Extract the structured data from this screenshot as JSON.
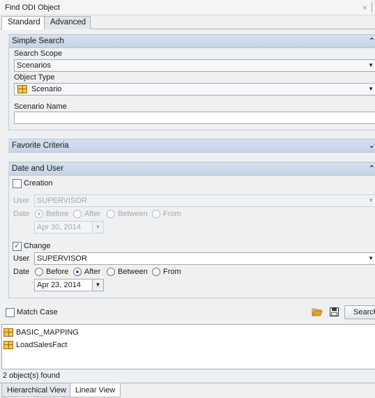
{
  "window": {
    "title": "Find ODI Object",
    "close_glyph": "×"
  },
  "tabs": [
    {
      "label": "Standard"
    },
    {
      "label": "Advanced"
    }
  ],
  "simple_search": {
    "header": "Simple Search",
    "search_scope_label": "Search Scope",
    "search_scope_value": "Scenarios",
    "object_type_label": "Object Type",
    "object_type_value": "Scenario",
    "object_type_icon": "grid-table-icon",
    "scenario_name_label": "Scenario Name",
    "scenario_name_value": ""
  },
  "favorite_criteria": {
    "header": "Favorite Criteria"
  },
  "date_and_user": {
    "header": "Date and User",
    "creation": {
      "label": "Creation",
      "checked": false,
      "user_label": "User",
      "user_value": "SUPERVISOR",
      "date_label": "Date",
      "options": [
        "Before",
        "After",
        "Between",
        "From"
      ],
      "selected": "Before",
      "date_value": "Apr 30, 2014"
    },
    "change": {
      "label": "Change",
      "checked": true,
      "user_label": "User",
      "user_value": "SUPERVISOR",
      "date_label": "Date",
      "options": [
        "Before",
        "After",
        "Between",
        "From"
      ],
      "selected": "After",
      "date_value": "Apr 23, 2014"
    }
  },
  "toolbar": {
    "match_case_label": "Match Case",
    "match_case_checked": false,
    "open_icon": "folder-open-icon",
    "save_icon": "save-disk-icon",
    "search_label": "Search"
  },
  "results": [
    {
      "name": "BASIC_MAPPING",
      "icon": "grid-table-icon"
    },
    {
      "name": "LoadSalesFact",
      "icon": "grid-table-icon"
    }
  ],
  "status": "2 object(s) found",
  "bottom_tabs": [
    {
      "label": "Hierarchical View"
    },
    {
      "label": "Linear View"
    }
  ],
  "colors": {
    "header_bg": "#c9d7e8",
    "accent": "#2d5fa8",
    "folder": "#e0a52e"
  }
}
